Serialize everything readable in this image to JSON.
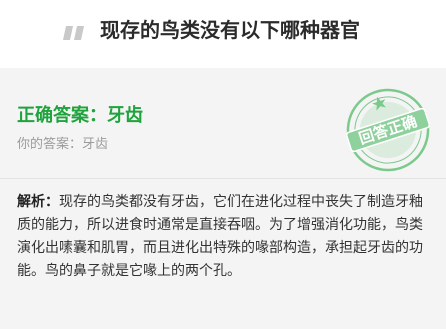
{
  "question": {
    "title": "现存的鸟类没有以下哪种器官",
    "icon": "quote-icon"
  },
  "answer": {
    "correct_label": "正确答案：",
    "correct_value": "牙齿",
    "your_label": "你的答案：",
    "your_value": "牙齿"
  },
  "stamp": {
    "text": "回答正确",
    "icon": "correct-stamp-icon"
  },
  "explanation": {
    "label": "解析：",
    "text": "现存的鸟类都没有牙齿，它们在进化过程中丧失了制造牙釉质的能力，所以进食时通常是直接吞咽。为了增强消化功能，鸟类演化出嗉囊和肌胃，而且进化出特殊的喙部构造，承担起牙齿的功能。鸟的鼻子就是它喙上的两个孔。"
  },
  "colors": {
    "correct_green": "#1fa33d",
    "stamp_green": "#7cc98c",
    "muted_text": "#9b9b9b",
    "background": "#f4f4f4"
  }
}
